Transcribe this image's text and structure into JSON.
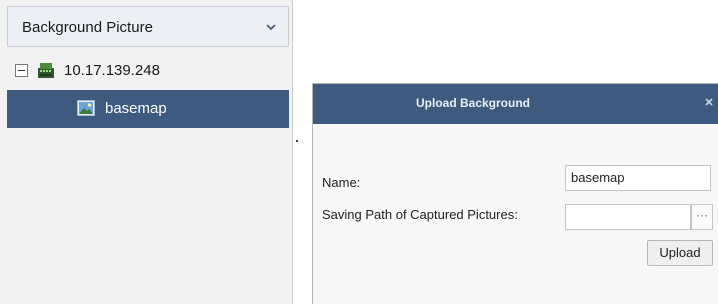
{
  "sidebar": {
    "title": "Background Picture",
    "tree": {
      "device": {
        "label": "10.17.139.248",
        "icon": "device-icon",
        "expanded": true
      },
      "map": {
        "label": "basemap",
        "icon": "image-icon",
        "selected": true
      }
    }
  },
  "dialog": {
    "title": "Upload Background",
    "fields": {
      "name_label": "Name:",
      "name_value": "basemap",
      "path_label": "Saving Path of Captured Pictures:",
      "path_value": "",
      "browse_label": "···"
    },
    "upload_label": "Upload"
  },
  "colors": {
    "selection": "#3e5a7f",
    "titlebar": "#3e5a7f",
    "panel_bg": "#f2f2f2"
  }
}
